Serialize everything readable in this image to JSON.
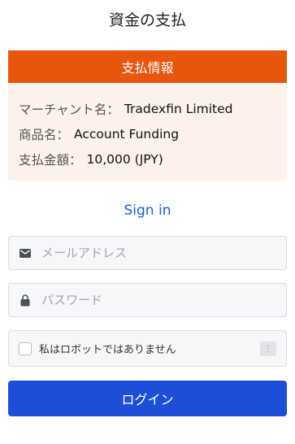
{
  "page_title": "資金の支払",
  "payment_info": {
    "header": "支払情報",
    "rows": [
      {
        "key": "マーチャント名：",
        "value": "Tradexfin Limited"
      },
      {
        "key": "商品名：",
        "value": "Account Funding"
      },
      {
        "key": "支払金額：",
        "value": "10,000 (JPY)"
      }
    ]
  },
  "signin_link": "Sign in",
  "email": {
    "placeholder": "メールアドレス",
    "value": "",
    "icon": "mail-icon"
  },
  "password": {
    "placeholder": "パスワード",
    "value": "",
    "icon": "lock-icon"
  },
  "captcha": {
    "label": "私はロボットではありません",
    "checked": false,
    "logo": "⋮"
  },
  "login_button": "ログイン",
  "colors": {
    "accent": "#e8560e",
    "panel_bg": "#fdf1ec",
    "link": "#1d5bd6",
    "button": "#1d4ed8"
  }
}
